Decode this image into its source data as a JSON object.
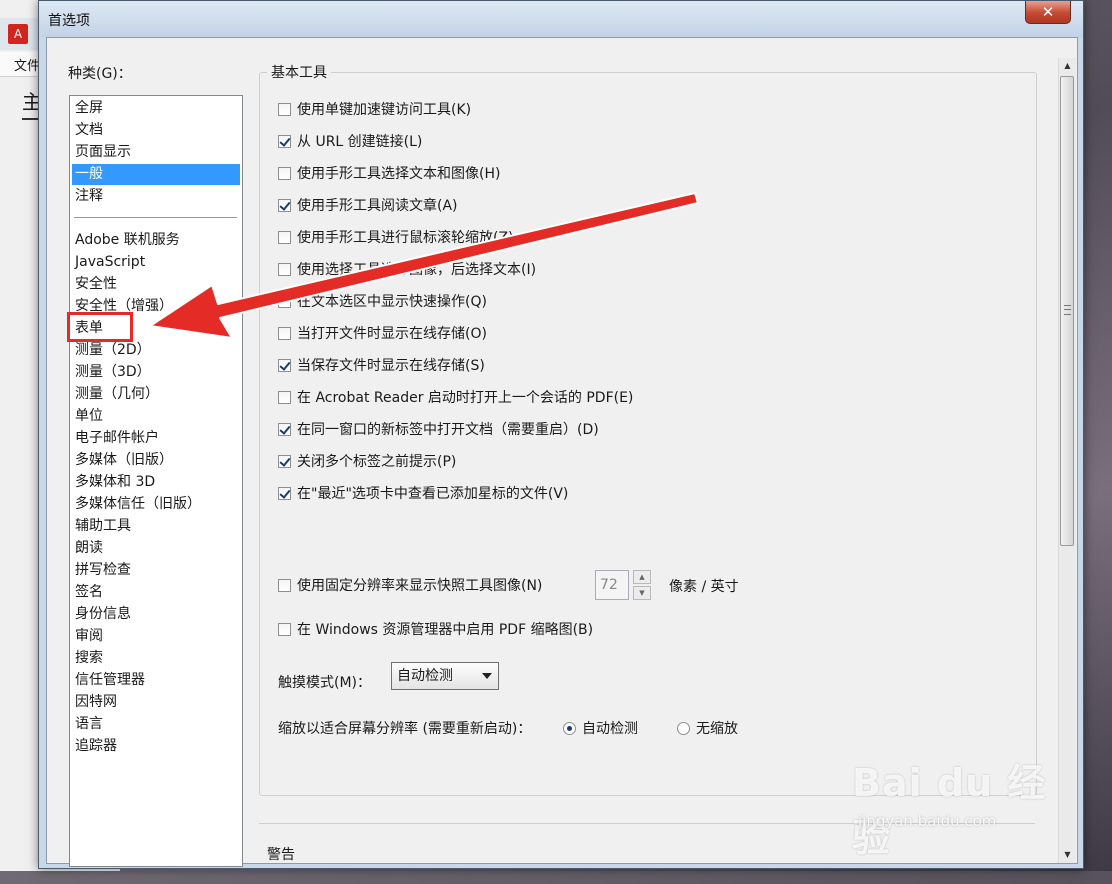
{
  "background_app": {
    "menu_label": "文件",
    "home_label": "主"
  },
  "dialog": {
    "title": "首选项",
    "close_glyph": "✕"
  },
  "categories": {
    "label": "种类(G)：",
    "group1": [
      "全屏",
      "文档",
      "页面显示",
      "一般",
      "注释"
    ],
    "group2": [
      "Adobe 联机服务",
      "JavaScript",
      "安全性",
      "安全性（增强）",
      "表单",
      "测量（2D）",
      "测量（3D）",
      "测量（几何）",
      "单位",
      "电子邮件帐户",
      "多媒体（旧版）",
      "多媒体和 3D",
      "多媒体信任（旧版）",
      "辅助工具",
      "朗读",
      "拼写检查",
      "签名",
      "身份信息",
      "审阅",
      "搜索",
      "信任管理器",
      "因特网",
      "语言",
      "追踪器"
    ],
    "selected": "一般",
    "highlighted": "表单"
  },
  "basic_tools": {
    "title": "基本工具",
    "options": [
      {
        "label": "使用单键加速键访问工具(K)",
        "checked": false
      },
      {
        "label": "从 URL 创建链接(L)",
        "checked": true
      },
      {
        "label": "使用手形工具选择文本和图像(H)",
        "checked": false
      },
      {
        "label": "使用手形工具阅读文章(A)",
        "checked": true
      },
      {
        "label": "使用手形工具进行鼠标滚轮缩放(Z)",
        "checked": false
      },
      {
        "label": "使用选择工具选择图像，后选择文本(I)",
        "checked": false
      },
      {
        "label": "在文本选区中显示快速操作(Q)",
        "checked": false
      },
      {
        "label": "当打开文件时显示在线存储(O)",
        "checked": false
      },
      {
        "label": "当保存文件时显示在线存储(S)",
        "checked": true
      },
      {
        "label": "在 Acrobat Reader 启动时打开上一个会话的 PDF(E)",
        "checked": false
      },
      {
        "label": "在同一窗口的新标签中打开文档（需要重启）(D)",
        "checked": true
      },
      {
        "label": "关闭多个标签之前提示(P)",
        "checked": true
      },
      {
        "label": "在\"最近\"选项卡中查看已添加星标的文件(V)",
        "checked": true
      }
    ],
    "snapshot": {
      "label": "使用固定分辨率来显示快照工具图像(N)",
      "checked": false,
      "value": "72",
      "unit": "像素 / 英寸"
    },
    "thumbnail": {
      "label": "在 Windows 资源管理器中启用 PDF 缩略图(B)",
      "checked": false
    },
    "touch_mode": {
      "label": "触摸模式(M)：",
      "value": "自动检测"
    },
    "scaling": {
      "label": "缩放以适合屏幕分辨率 (需要重新启动)：",
      "options": [
        "自动检测",
        "无缩放"
      ],
      "selected": "自动检测"
    }
  },
  "warnings": {
    "title": "警告"
  },
  "watermark": {
    "main": "Bai du 经验",
    "sub": "jingyan.baidu.com"
  },
  "colors": {
    "selection": "#3399ff",
    "annotation_red": "#e52b26",
    "dialog_frame": "#c9d8e9"
  }
}
